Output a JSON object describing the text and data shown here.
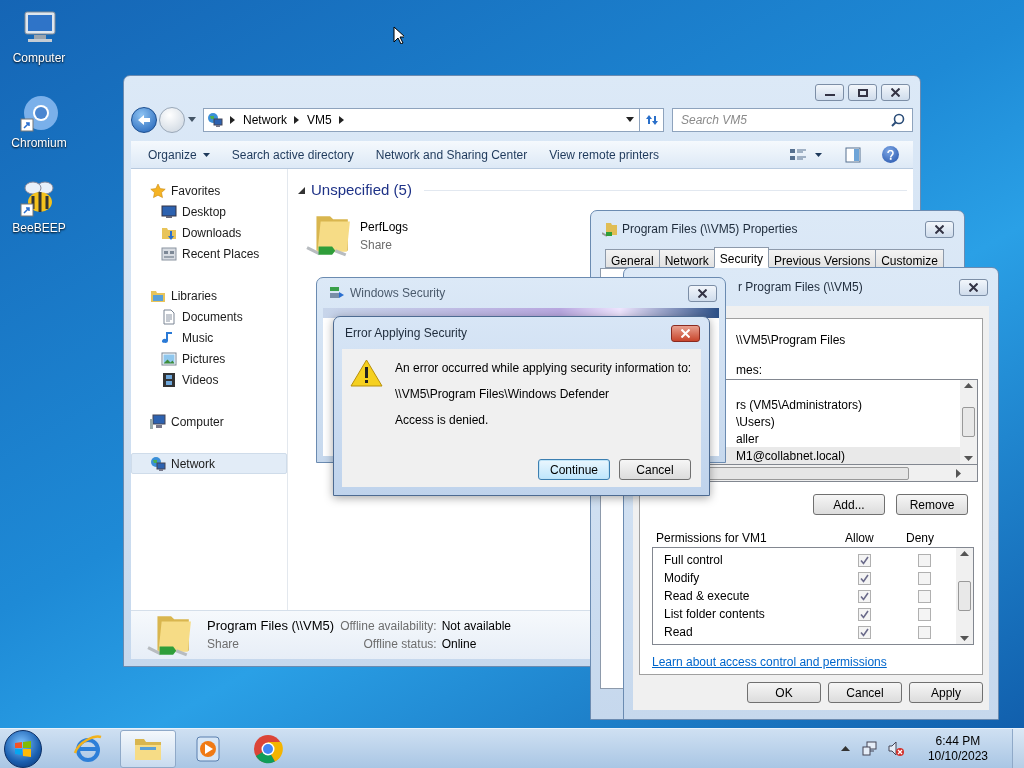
{
  "desktop_icons": [
    {
      "label": "Computer",
      "kind": "computer"
    },
    {
      "label": "Chromium",
      "kind": "chromium"
    },
    {
      "label": "BeeBEEP",
      "kind": "bee"
    }
  ],
  "explorer": {
    "breadcrumb": [
      "Network",
      "VM5"
    ],
    "search_placeholder": "Search VM5",
    "toolbar": [
      {
        "label": "Organize",
        "dropdown": true
      },
      {
        "label": "Search active directory",
        "dropdown": false
      },
      {
        "label": "Network and Sharing Center",
        "dropdown": false
      },
      {
        "label": "View remote printers",
        "dropdown": false
      }
    ],
    "nav": [
      {
        "label": "Favorites",
        "kind": "star",
        "selected": false,
        "children": [
          {
            "label": "Desktop",
            "kind": "desktop",
            "selected": false
          },
          {
            "label": "Downloads",
            "kind": "downloads",
            "selected": false
          },
          {
            "label": "Recent Places",
            "kind": "recent",
            "selected": false
          }
        ]
      },
      {
        "label": "Libraries",
        "kind": "libraries",
        "selected": false,
        "children": [
          {
            "label": "Documents",
            "kind": "documents",
            "selected": false
          },
          {
            "label": "Music",
            "kind": "music",
            "selected": false
          },
          {
            "label": "Pictures",
            "kind": "pictures",
            "selected": false
          },
          {
            "label": "Videos",
            "kind": "videos",
            "selected": false
          }
        ]
      },
      {
        "label": "Computer",
        "kind": "computer",
        "selected": false
      },
      {
        "label": "Network",
        "kind": "network",
        "selected": true
      }
    ],
    "group": {
      "title": "Unspecified (5)",
      "expanded": true
    },
    "items": [
      {
        "name": "PerfLogs",
        "type": "Share"
      }
    ],
    "details": {
      "name": "Program Files (\\\\VM5)",
      "type": "Share",
      "fields": [
        {
          "label": "Offline availability:",
          "value": "Not available"
        },
        {
          "label": "Offline status:",
          "value": "Online"
        }
      ]
    }
  },
  "properties": {
    "title": "Program Files (\\\\VM5) Properties",
    "tabs": [
      {
        "label": "General",
        "selected": false
      },
      {
        "label": "Network",
        "selected": false
      },
      {
        "label": "Security",
        "selected": true
      },
      {
        "label": "Previous Versions",
        "selected": false
      },
      {
        "label": "Customize",
        "selected": false
      }
    ]
  },
  "permissions": {
    "title": "r Program Files (\\\\VM5)",
    "object_name": "\\\\VM5\\Program Files",
    "names_label": "mes:",
    "names": [
      {
        "text": "rs (VM5\\Administrators)",
        "selected": false
      },
      {
        "text": "\\Users)",
        "selected": false
      },
      {
        "text": "aller",
        "selected": false
      },
      {
        "text": "M1@collabnet.local)",
        "selected": true
      }
    ],
    "add": "Add...",
    "remove": "Remove",
    "permissions_label": "Permissions for VM1",
    "columns": [
      "Allow",
      "Deny"
    ],
    "rows": [
      {
        "name": "Full control",
        "allow": true,
        "deny": false
      },
      {
        "name": "Modify",
        "allow": true,
        "deny": false
      },
      {
        "name": "Read & execute",
        "allow": true,
        "deny": false
      },
      {
        "name": "List folder contents",
        "allow": true,
        "deny": false
      },
      {
        "name": "Read",
        "allow": true,
        "deny": false
      }
    ],
    "link": "Learn about access control and permissions",
    "buttons": [
      "OK",
      "Cancel",
      "Apply"
    ]
  },
  "windows_security": {
    "title": "Windows Security"
  },
  "error": {
    "title": "Error Applying Security",
    "lines": [
      "An error occurred while applying security information to:",
      "\\\\VM5\\Program Files\\Windows Defender",
      "Access is denied."
    ],
    "buttons": [
      {
        "label": "Continue",
        "default": true
      },
      {
        "label": "Cancel",
        "default": false
      }
    ]
  },
  "taskbar": {
    "apps": [
      {
        "kind": "ie",
        "active": false
      },
      {
        "kind": "explorer",
        "active": true
      },
      {
        "kind": "media",
        "active": false
      },
      {
        "kind": "chrome",
        "active": false
      }
    ],
    "time": "6:44 PM",
    "date": "10/10/2023"
  }
}
